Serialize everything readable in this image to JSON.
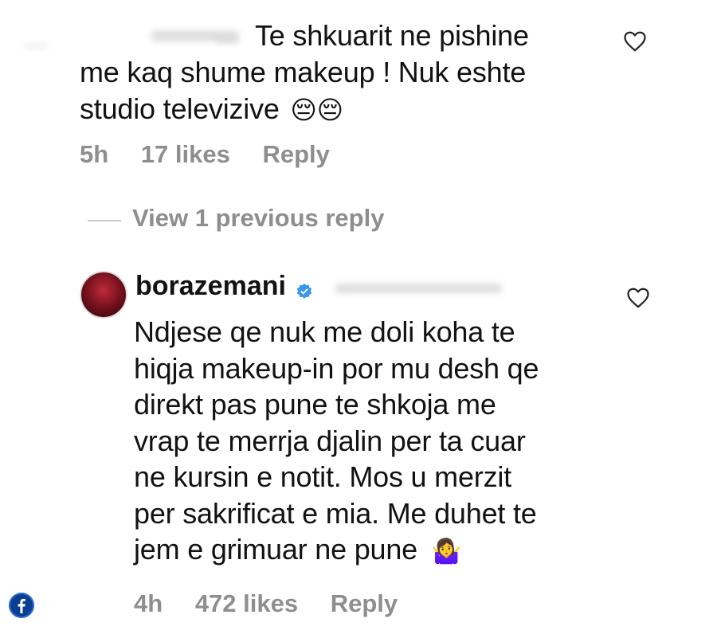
{
  "comment1": {
    "line1": "Te shkuarit ne pishine",
    "line2": "me  kaq shume makeup ! Nuk eshte",
    "line3": "studio televizive",
    "emoji": "😔😔",
    "time": "5h",
    "likes": "17 likes",
    "reply": "Reply"
  },
  "thread": {
    "view_replies": "View 1 previous reply"
  },
  "comment2": {
    "username": "borazemani",
    "lines": [
      "Ndjese qe nuk me doli koha te",
      "hiqja makeup-in por mu desh qe",
      "direkt pas pune te shkoja me",
      "vrap te merrja djalin per ta cuar",
      "ne kursin e notit. Mos u merzit",
      "per sakrificat e mia. Me duhet te",
      "jem e grimuar ne pune"
    ],
    "emoji": "🤷‍♀️",
    "time": "4h",
    "likes": "472 likes",
    "reply": "Reply"
  },
  "icons": {
    "heart": "heart-icon",
    "verified": "verified-badge-icon",
    "facebook": "facebook-icon"
  },
  "colors": {
    "text": "#121212",
    "meta": "#8e8e8e",
    "verified": "#3897f0",
    "facebook": "#0b3d91"
  }
}
